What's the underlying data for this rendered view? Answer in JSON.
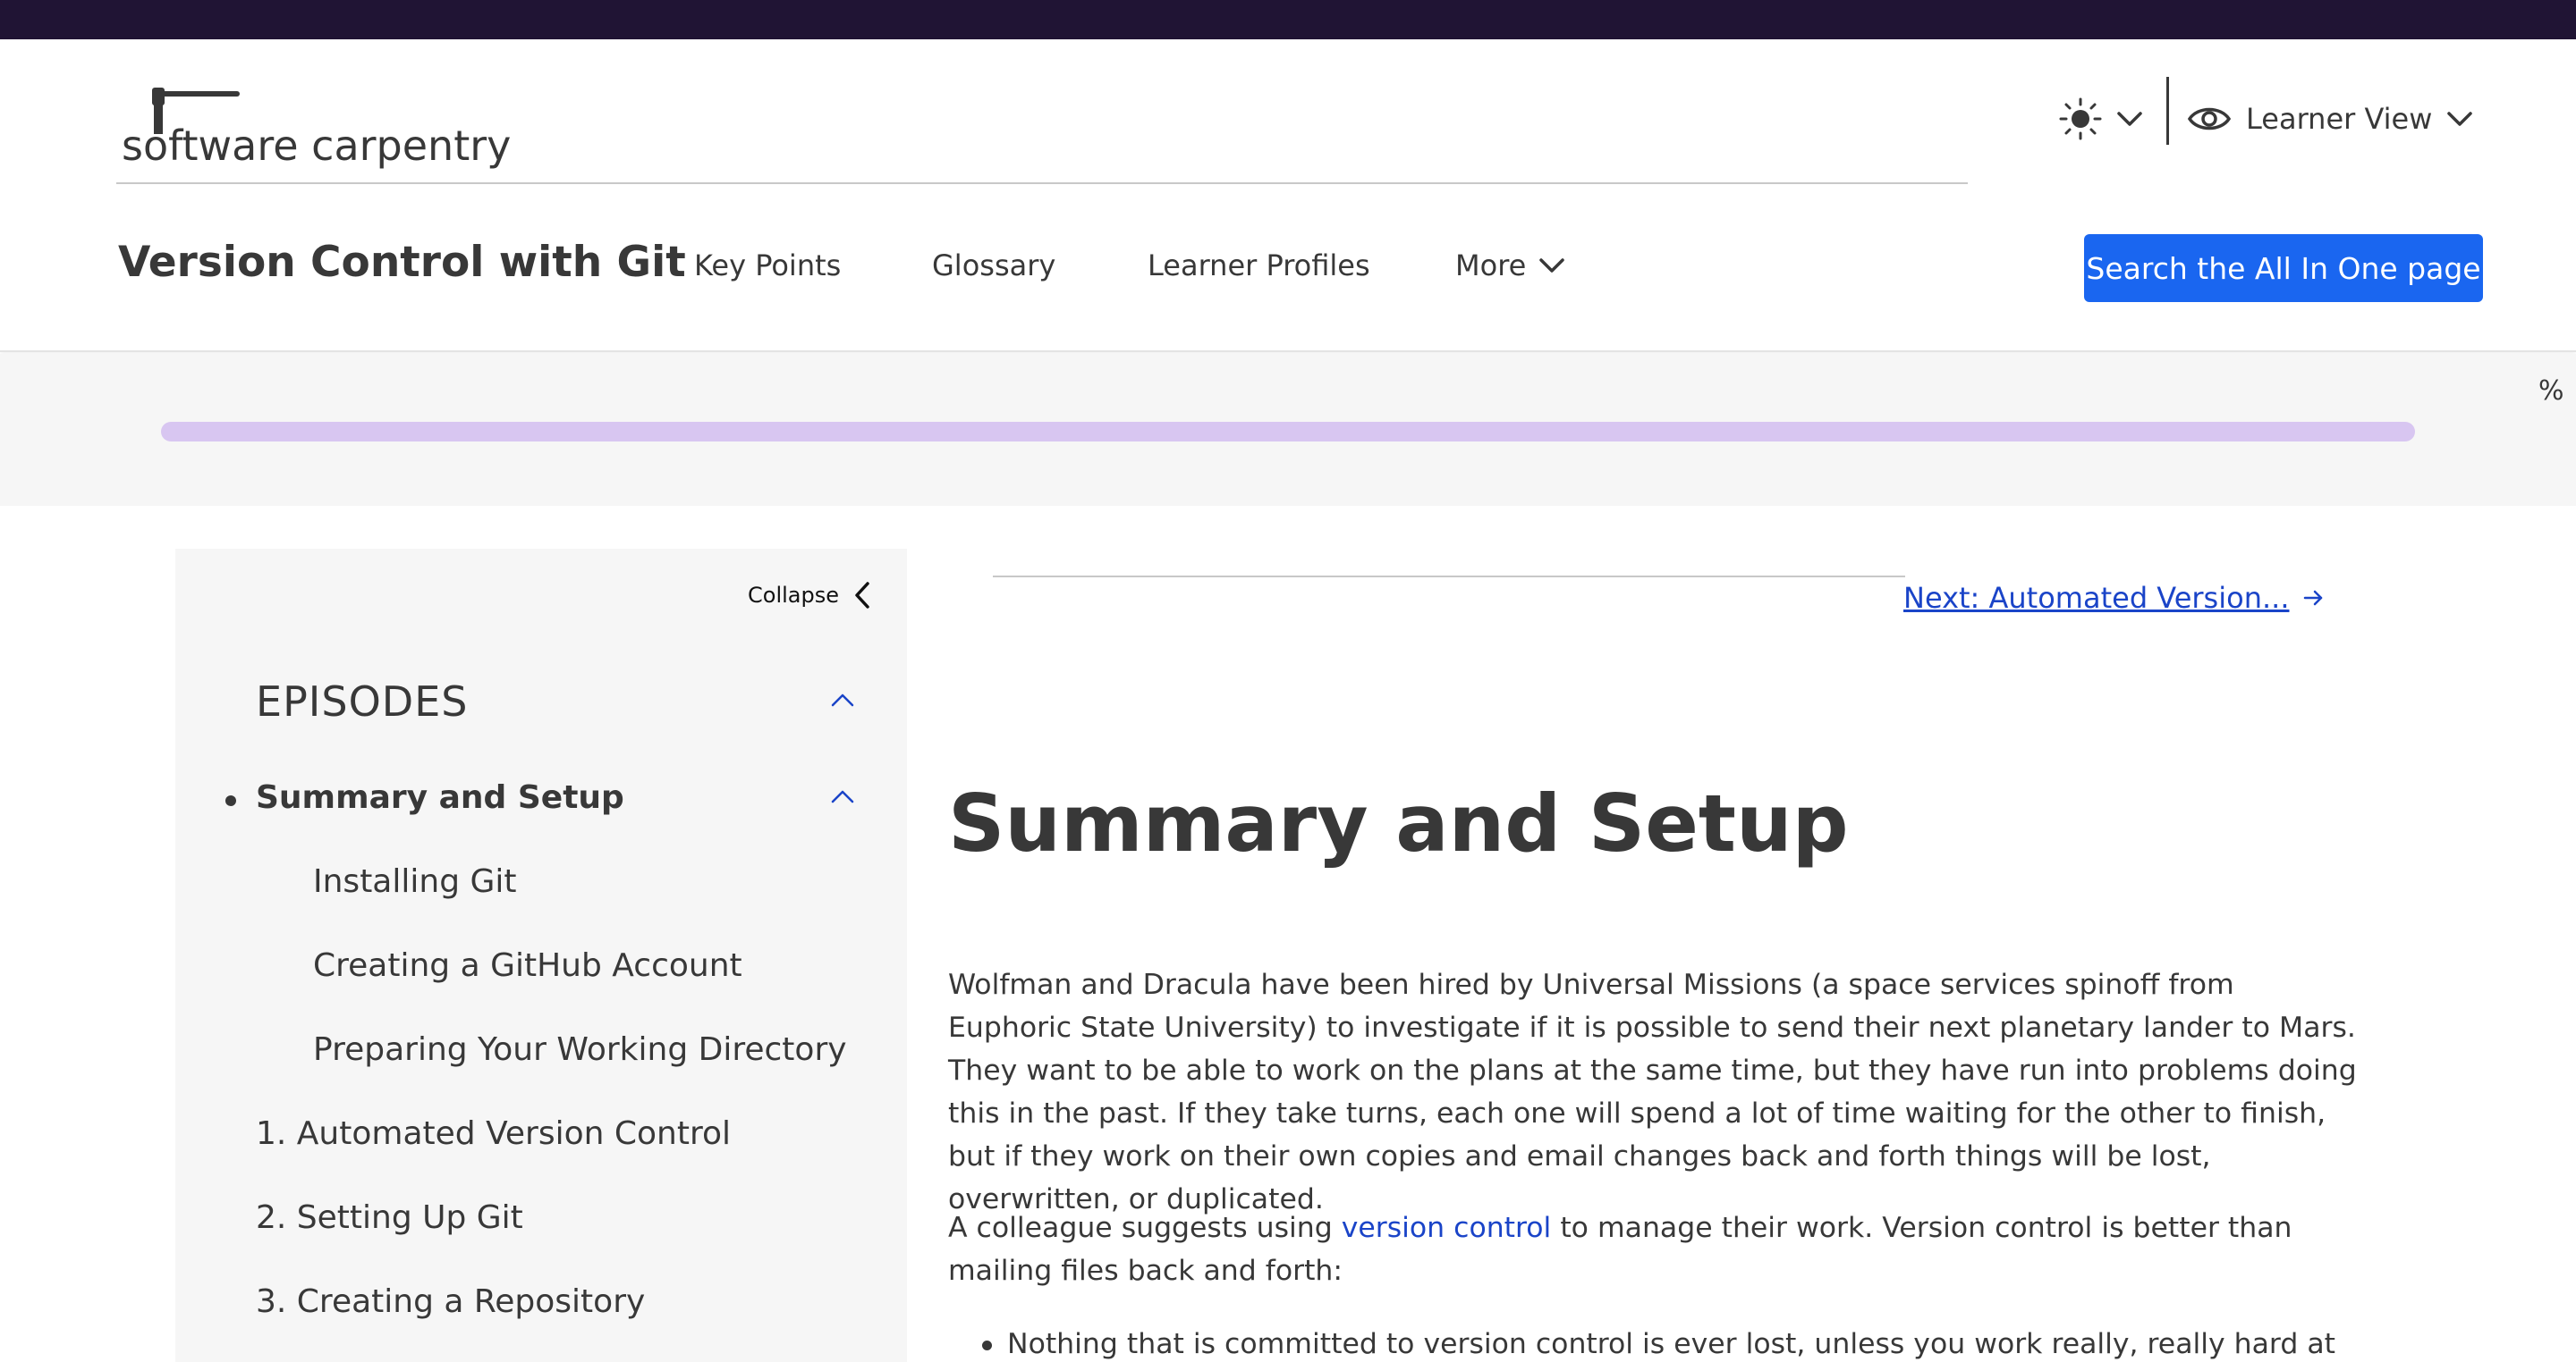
{
  "header": {
    "logo_text": "software carpentry",
    "site_title": "Version Control with Git",
    "view_label": "Learner View",
    "nav": [
      {
        "label": "Key Points"
      },
      {
        "label": "Glossary"
      },
      {
        "label": "Learner Profiles"
      },
      {
        "label": "More"
      }
    ],
    "search_label": "Search the All In One page",
    "icons": {
      "theme": "sun-icon",
      "view": "eye-icon",
      "dropdown": "chevron-down-icon"
    }
  },
  "progress": {
    "value_percent": 0,
    "unit_label": "%"
  },
  "sidebar": {
    "collapse_label": "Collapse",
    "episodes_heading": "EPISODES",
    "items": [
      {
        "label": "Summary and Setup",
        "current": true
      },
      {
        "label": "Installing Git"
      },
      {
        "label": "Creating a GitHub Account"
      },
      {
        "label": "Preparing Your Working Directory"
      },
      {
        "label": "1. Automated Version Control"
      },
      {
        "label": "2. Setting Up Git"
      },
      {
        "label": "3. Creating a Repository"
      }
    ]
  },
  "content": {
    "next_label": "Next: Automated Version...",
    "title": "Summary and Setup",
    "paragraph1": "Wolfman and Dracula have been hired by Universal Missions (a space services spinoff from Euphoric State University) to investigate if it is possible to send their next planetary lander to Mars. They want to be able to work on the plans at the same time, but they have run into problems doing this in the past. If they take turns, each one will spend a lot of time waiting for the other to finish, but if they work on their own copies and email changes back and forth things will be lost, overwritten, or duplicated.",
    "paragraph2_before": "A colleague suggests using ",
    "paragraph2_link": "version control",
    "paragraph2_after": " to manage their work. Version control is better than mailing files back and forth:",
    "list": [
      "Nothing that is committed to version control is ever lost, unless you work really, really hard at losing it."
    ]
  },
  "colors": {
    "accent": "#1a66f0",
    "link": "#1a44c8",
    "topbar": "#201434",
    "progress_track": "#d8c6f1"
  }
}
